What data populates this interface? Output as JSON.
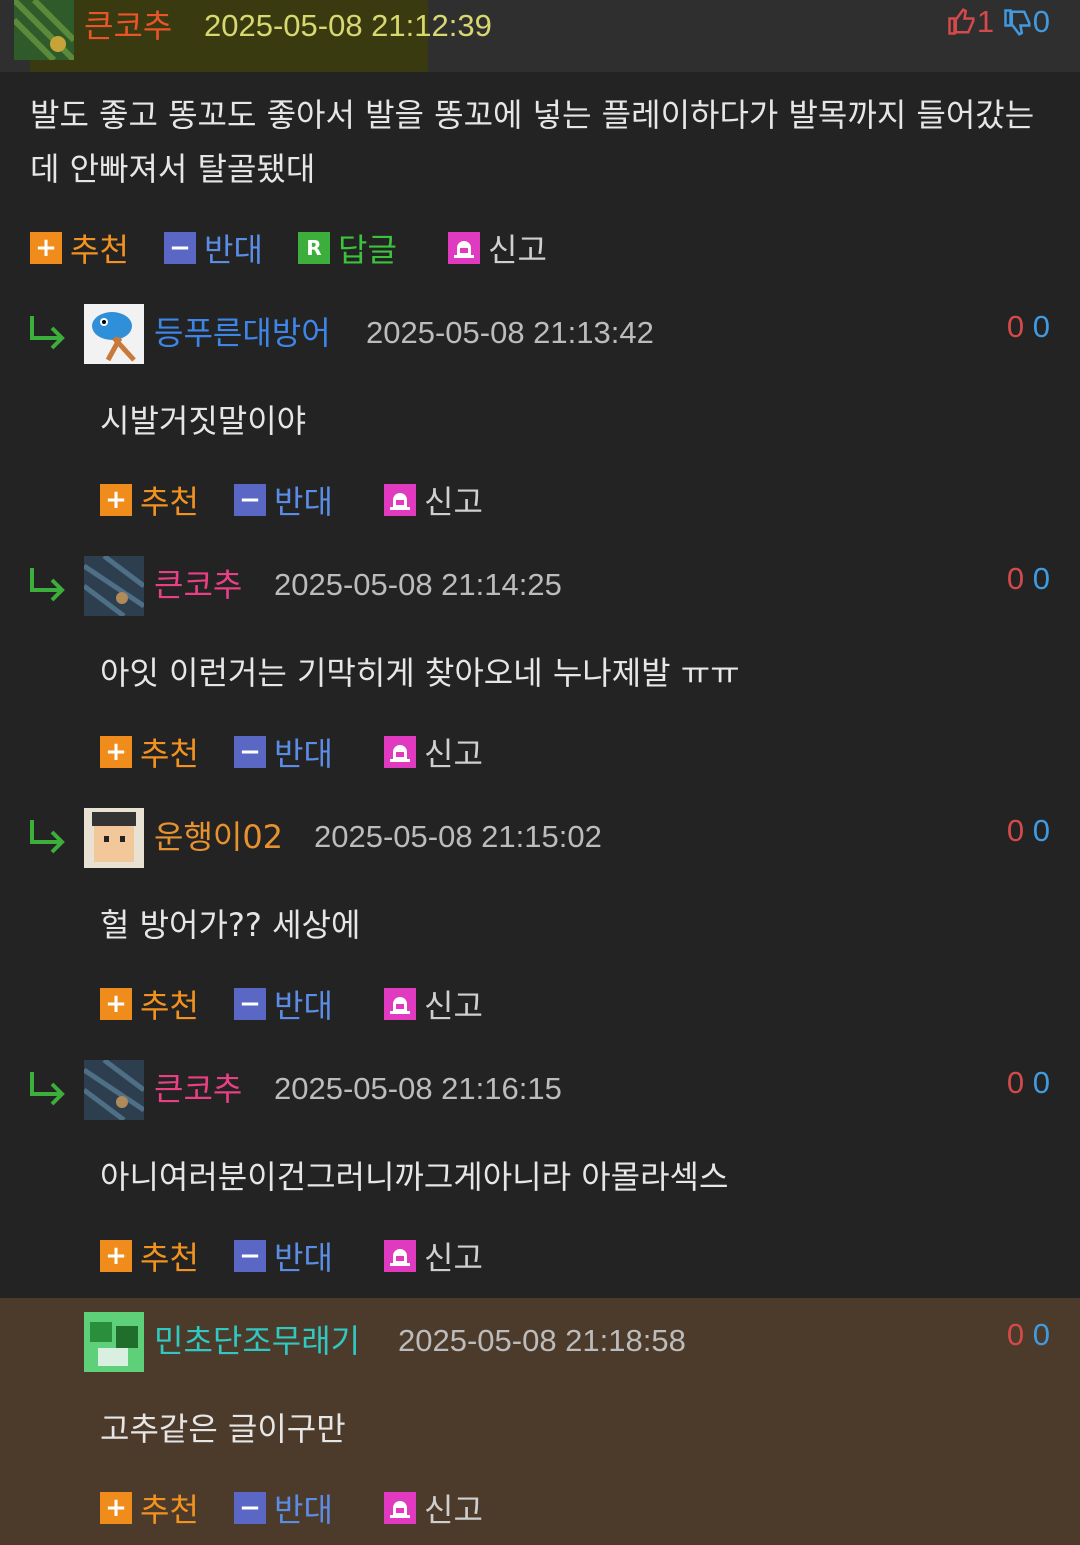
{
  "comments": [
    {
      "nick": "큰코추",
      "nick_color": "#e8552b",
      "time": "2025-05-08 21:12:39",
      "up": "1",
      "down": "0",
      "body": "발도 좋고 똥꼬도 좋아서 발을 똥꼬에 넣는 플레이하다가 발목까지 들어갔는데 안빠져서 탈골됐대",
      "actions": {
        "recommend": "추천",
        "oppose": "반대",
        "reply": "답글",
        "report": "신고"
      }
    },
    {
      "nick": "등푸른대방어",
      "nick_color": "#3d86e8",
      "time": "2025-05-08 21:13:42",
      "up": "0",
      "down": "0",
      "body": "시발거짓말이야",
      "actions": {
        "recommend": "추천",
        "oppose": "반대",
        "report": "신고"
      }
    },
    {
      "nick": "큰코추",
      "nick_color": "#e83f85",
      "time": "2025-05-08 21:14:25",
      "up": "0",
      "down": "0",
      "body": "아잇 이런거는 기막히게 찾아오네 누나제발 ㅠㅠ",
      "actions": {
        "recommend": "추천",
        "oppose": "반대",
        "report": "신고"
      }
    },
    {
      "nick": "운행이02",
      "nick_color": "#e8912f",
      "time": "2025-05-08 21:15:02",
      "up": "0",
      "down": "0",
      "body": "헐 방어가?? 세상에",
      "actions": {
        "recommend": "추천",
        "oppose": "반대",
        "report": "신고"
      }
    },
    {
      "nick": "큰코추",
      "nick_color": "#e83f85",
      "time": "2025-05-08 21:16:15",
      "up": "0",
      "down": "0",
      "body": "아니여러분이건그러니까그게아니라 아몰라섹스",
      "actions": {
        "recommend": "추천",
        "oppose": "반대",
        "report": "신고"
      }
    },
    {
      "nick": "민초단조무래기",
      "nick_color": "#2fc9c4",
      "time": "2025-05-08 21:18:58",
      "up": "0",
      "down": "0",
      "body": "고추같은 글이구만",
      "actions": {
        "recommend": "추천",
        "oppose": "반대",
        "report": "신고"
      }
    }
  ]
}
